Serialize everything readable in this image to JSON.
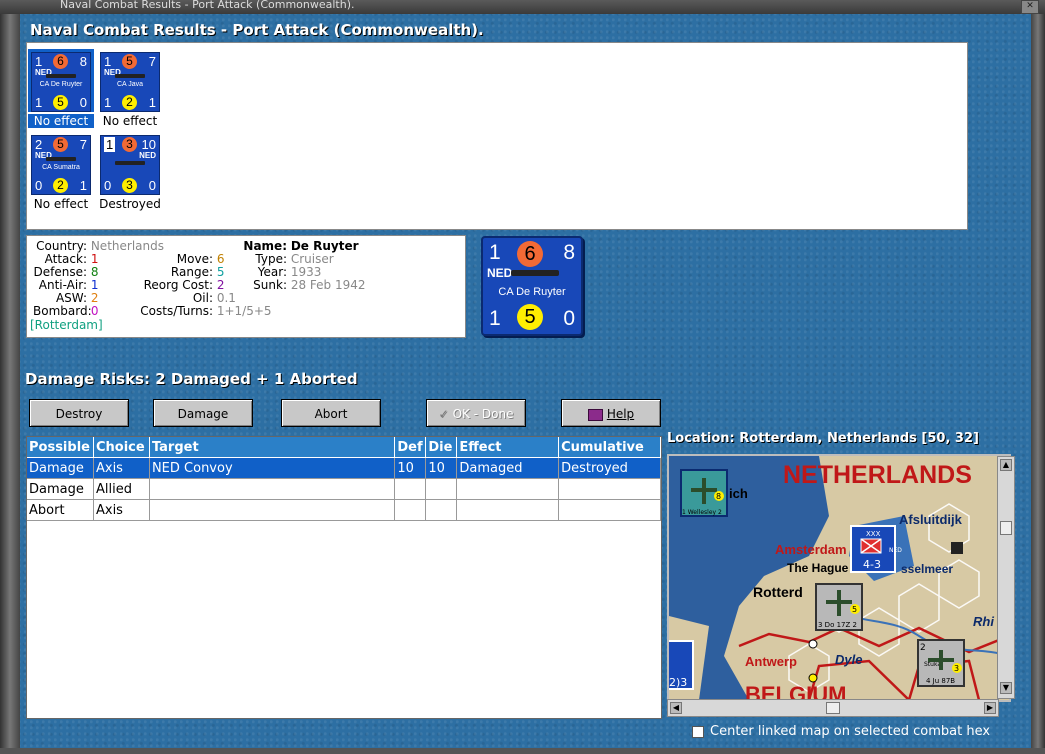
{
  "window": {
    "title": "Naval Combat Results - Port Attack (Commonwealth)."
  },
  "panel_title": "Naval Combat Results - Port Attack (Commonwealth).",
  "units": [
    {
      "tl": "1",
      "top": "6",
      "tr": "8",
      "nation": "NED",
      "name": "CA De Ruyter",
      "bl": "1",
      "bottom": "5",
      "br": "0",
      "result": "No effect",
      "selected": true
    },
    {
      "tl": "1",
      "top": "5",
      "tr": "7",
      "nation": "NED",
      "name": "CA Java",
      "bl": "1",
      "bottom": "2",
      "br": "1",
      "result": "No effect",
      "selected": false
    },
    {
      "tl": "2",
      "top": "5",
      "tr": "7",
      "nation": "NED",
      "name": "CA Sumatra",
      "bl": "0",
      "bottom": "2",
      "br": "1",
      "result": "No effect",
      "selected": false
    },
    {
      "tl": "1",
      "top": "3",
      "tr": "10",
      "nation": "NED",
      "name": "",
      "bl": "0",
      "bottom": "3",
      "br": "0",
      "result": "Destroyed",
      "selected": false
    }
  ],
  "info": {
    "country_label": "Country:",
    "country": "Netherlands",
    "attack_label": "Attack:",
    "attack": "1",
    "defense_label": "Defense:",
    "defense": "8",
    "antiair_label": "Anti-Air:",
    "antiair": "1",
    "asw_label": "ASW:",
    "asw": "2",
    "bombard_label": "Bombard:",
    "bombard": "0",
    "location": "[Rotterdam]",
    "move_label": "Move:",
    "move": "6",
    "range_label": "Range:",
    "range": "5",
    "reorg_label": "Reorg Cost:",
    "reorg": "2",
    "oil_label": "Oil:",
    "oil": "0.1",
    "costs_label": "Costs/Turns:",
    "costs": "1+1/5+5",
    "name_label": "Name:",
    "name": "De Ruyter",
    "type_label": "Type:",
    "type": "Cruiser",
    "year_label": "Year:",
    "year": "1933",
    "sunk_label": "Sunk:",
    "sunk": "28 Feb 1942"
  },
  "big_counter": {
    "tl": "1",
    "top": "6",
    "tr": "8",
    "nation": "NED",
    "name": "CA De Ruyter",
    "bl": "1",
    "bottom": "5",
    "br": "0"
  },
  "damage_risks": "Damage Risks: 2 Damaged + 1 Aborted",
  "buttons": {
    "destroy": "Destroy",
    "damage": "Damage",
    "abort": "Abort",
    "ok": "OK - Done",
    "help": "Help"
  },
  "table": {
    "headers": [
      "Possible",
      "Choice",
      "Target",
      "Def",
      "Die",
      "Effect",
      "Cumulative"
    ],
    "rows": [
      [
        "Damage",
        "Axis",
        "NED Convoy",
        "10",
        "10",
        "Damaged",
        "Destroyed"
      ],
      [
        "Damage",
        "Allied",
        "",
        "",
        "",
        "",
        ""
      ],
      [
        "Abort",
        "Axis",
        "",
        "",
        "",
        "",
        ""
      ]
    ]
  },
  "location_label": "Location:  Rotterdam, Netherlands [50, 32]",
  "map": {
    "labels": {
      "netherlands": "NETHERLANDS",
      "afsluitdijk": "Afsluitdijk",
      "amsterdam": "Amsterdam",
      "hague": "The Hague",
      "ijssel": "sselmeer",
      "rotterdam": "Rotterd",
      "antwerp": "Antwerp",
      "dyle": "Dyle",
      "belgium": "BELGIUM",
      "rhine": "Rhi",
      "ich": "ich"
    },
    "units": {
      "wellesley": {
        "label": "1 Wellesley 2",
        "value": "8"
      },
      "xxx": {
        "label": "4-3",
        "tag": "XXX",
        "nation": "NED"
      },
      "do17": {
        "label": "3 Do 17Z 2",
        "value": "5"
      },
      "stuka": {
        "label": "4 Ju 87B",
        "value": "3",
        "top": "2",
        "type": "Stuka"
      },
      "left_edge": "2)3"
    }
  },
  "center_checkbox_label": "Center linked map on selected combat hex"
}
